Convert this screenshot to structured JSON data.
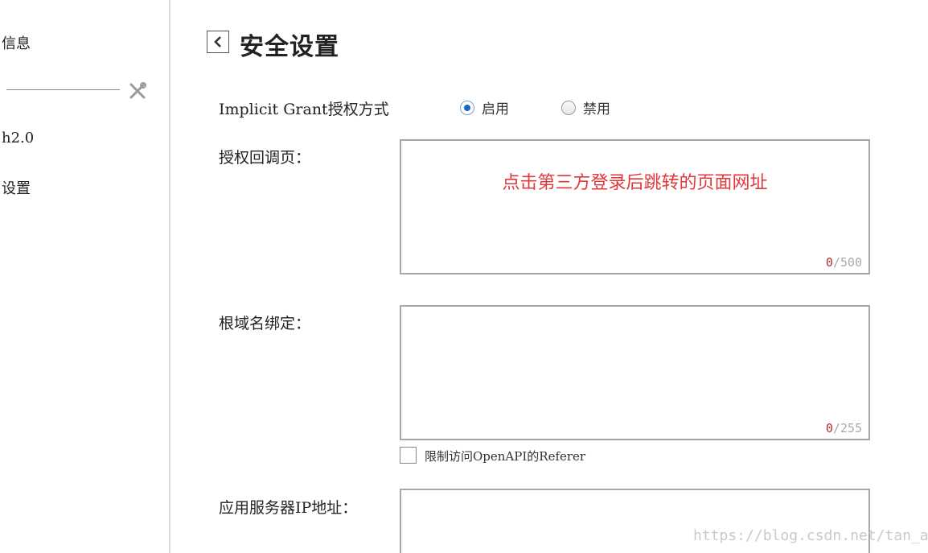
{
  "sidebar": {
    "items": [
      {
        "label": "信息"
      },
      {
        "label": "h2.0"
      },
      {
        "label": "设置"
      }
    ],
    "tool_icon": "tools-icon"
  },
  "header": {
    "back_icon": "chevron-left-icon",
    "title": "安全设置"
  },
  "form": {
    "implicit_grant": {
      "label": "Implicit Grant授权方式",
      "options": [
        {
          "label": "启用",
          "selected": true
        },
        {
          "label": "禁用",
          "selected": false
        }
      ]
    },
    "callback": {
      "label": "授权回调页：",
      "placeholder": "点击第三方登录后跳转的页面网址",
      "count": "0",
      "max": "/500"
    },
    "root_domain": {
      "label": "根域名绑定：",
      "value": "",
      "count": "0",
      "max": "/255",
      "restrict_label": "限制访问OpenAPI的Referer",
      "restrict_checked": false
    },
    "server_ip": {
      "label": "应用服务器IP地址：",
      "value": ""
    }
  },
  "watermark": "https://blog.csdn.net/tan_ai",
  "colors": {
    "accent": "#1a66c9",
    "placeholder_red": "#e0383b",
    "border": "#a6a6a6"
  }
}
